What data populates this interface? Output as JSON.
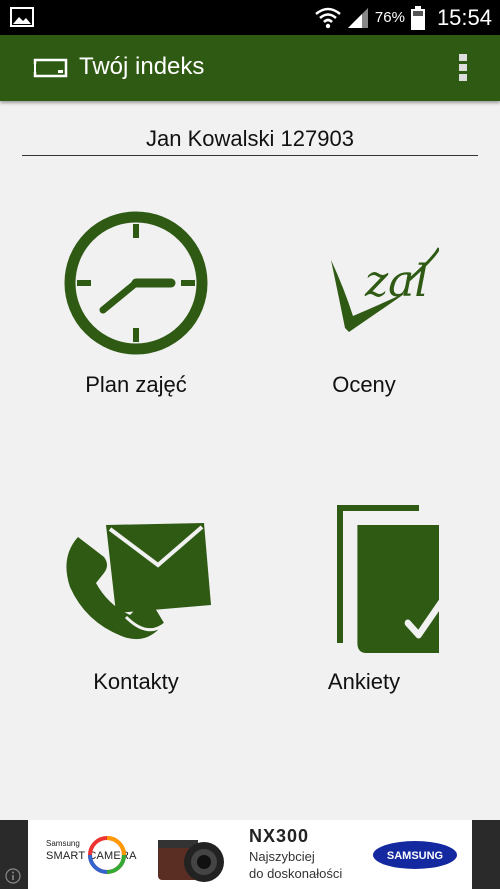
{
  "status_bar": {
    "battery_percent": "76%",
    "time": "15:54",
    "icons": [
      "gallery-icon",
      "wifi-icon",
      "signal-icon",
      "battery-icon"
    ]
  },
  "app_bar": {
    "title": "Twój indeks",
    "icons": [
      "id-card-icon",
      "overflow-menu-icon"
    ]
  },
  "user": {
    "name_and_id": "Jan Kowalski 127903"
  },
  "tiles": [
    {
      "label": "Plan zajęć",
      "icon": "clock-icon"
    },
    {
      "label": "Oceny",
      "icon": "grade-zal-icon",
      "icon_text": "zal"
    },
    {
      "label": "Kontakty",
      "icon": "phone-envelope-icon"
    },
    {
      "label": "Ankiety",
      "icon": "survey-check-icon"
    }
  ],
  "ad": {
    "brand_small": "Samsung",
    "brand_big": "SMART CAMERA",
    "product": "NX300",
    "tagline_line1": "Najszybciej",
    "tagline_line2": "do doskonałości",
    "logo_text": "SAMSUNG"
  },
  "colors": {
    "accent_green": "#2f5a13",
    "background": "#f1f1f1",
    "status_bar": "#000000",
    "samsung_blue": "#1428a0"
  }
}
